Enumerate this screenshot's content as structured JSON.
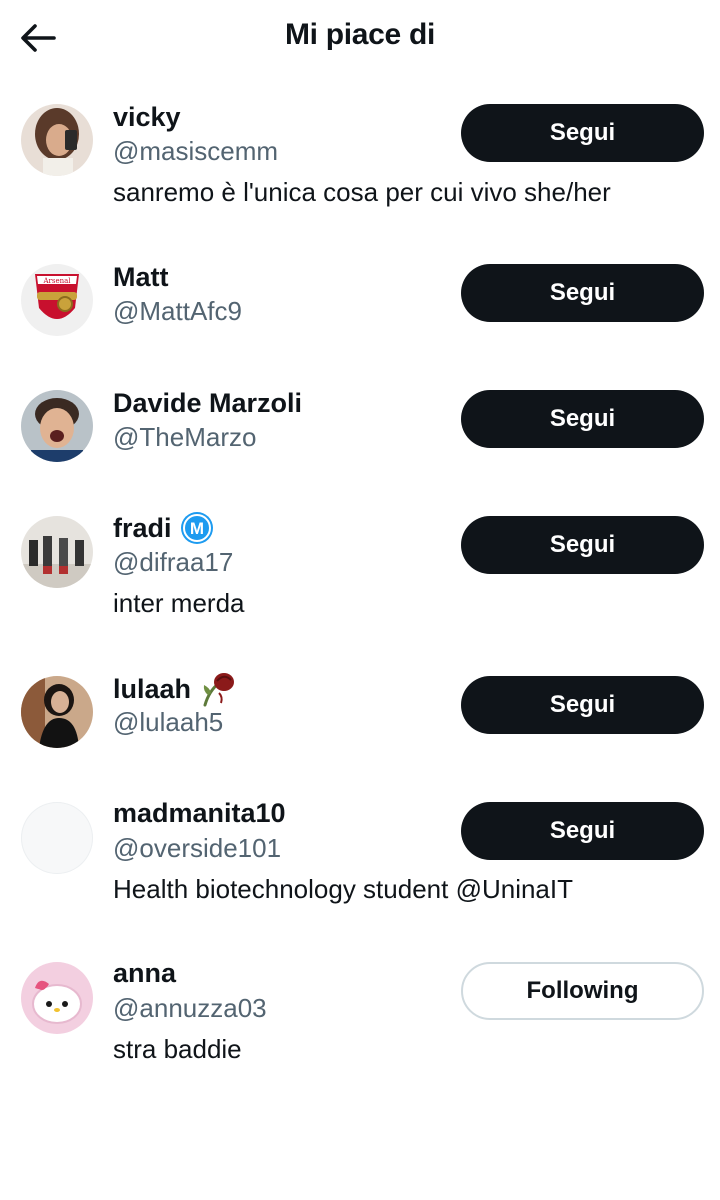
{
  "header": {
    "title": "Mi piace di"
  },
  "users": [
    {
      "display_name": "vicky",
      "handle": "@masiscemm",
      "bio": "sanremo è l'unica cosa per cui vivo she/her",
      "button_label": "Segui"
    },
    {
      "display_name": "Matt",
      "handle": "@MattAfc9",
      "bio": "",
      "button_label": "Segui",
      "avatar_text": "Arsenal"
    },
    {
      "display_name": "Davide Marzoli",
      "handle": "@TheMarzo",
      "bio": "",
      "button_label": "Segui"
    },
    {
      "display_name": "fradi",
      "handle": "@difraa17",
      "bio": "inter merda",
      "button_label": "Segui",
      "badge_letter": "M"
    },
    {
      "display_name": "lulaah",
      "handle": "@lulaah5",
      "bio": "",
      "button_label": "Segui"
    },
    {
      "display_name": "madmanita10",
      "handle": "@overside101",
      "bio": "Health biotechnology student @UninaIT",
      "button_label": "Segui"
    },
    {
      "display_name": "anna",
      "handle": "@annuzza03",
      "bio": "stra baddie",
      "button_label": "Following"
    }
  ],
  "colors": {
    "text_primary": "#0f1419",
    "text_secondary": "#536471",
    "button_bg": "#0f1419",
    "button_outline": "#cfd9de",
    "badge_blue": "#1d9bf0"
  },
  "icons": {
    "back": "arrow-left-icon",
    "badge": "metaverse-m-badge-icon",
    "emoji": "wilted-rose-emoji"
  }
}
